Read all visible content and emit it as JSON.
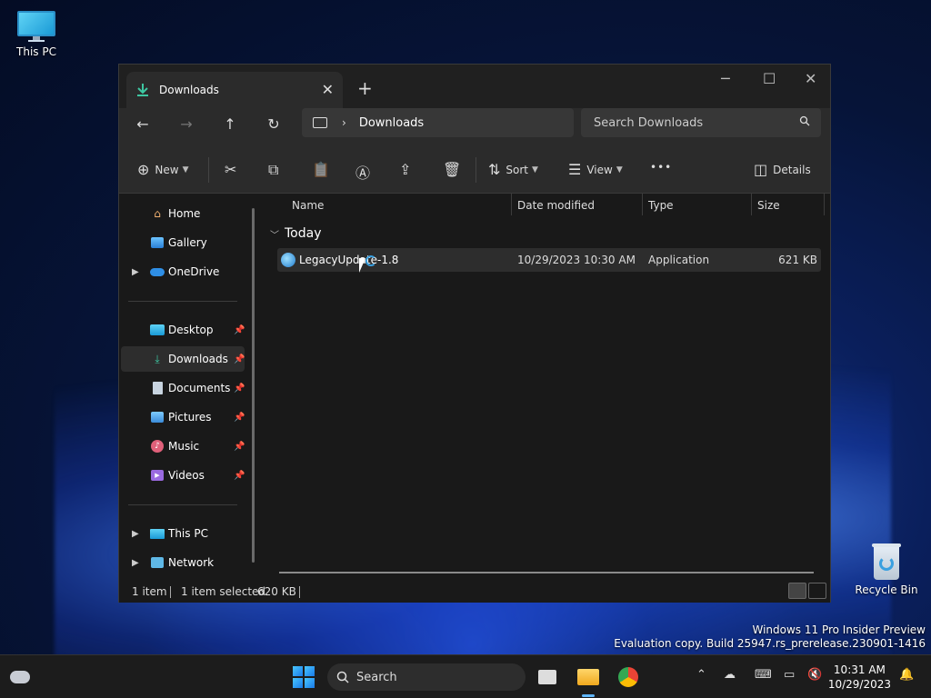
{
  "desktop": {
    "this_pc_label": "This PC",
    "recycle_bin_label": "Recycle Bin",
    "watermark_line1": "Windows 11 Pro Insider Preview",
    "watermark_line2": "Evaluation copy. Build 25947.rs_prerelease.230901-1416"
  },
  "window": {
    "tab_label": "Downloads",
    "tab_close": "✕",
    "new_tab": "+",
    "min": "─",
    "max": "☐",
    "close": "✕"
  },
  "address": {
    "back": "←",
    "forward": "→",
    "up": "↑",
    "refresh": "↻",
    "chevron": "›",
    "crumb": "Downloads",
    "search_placeholder": "Search Downloads"
  },
  "commands": {
    "new": "New",
    "cut": "✂",
    "copy": "⧉",
    "paste": "📋",
    "rename": "Ⓐ",
    "share": "⇪",
    "delete": "🗑",
    "sort": "Sort",
    "view": "View",
    "more": "•••",
    "details": "Details"
  },
  "nav": {
    "items": [
      {
        "label": "Home"
      },
      {
        "label": "Gallery"
      },
      {
        "label": "OneDrive"
      },
      {
        "label": "Desktop"
      },
      {
        "label": "Downloads"
      },
      {
        "label": "Documents"
      },
      {
        "label": "Pictures"
      },
      {
        "label": "Music"
      },
      {
        "label": "Videos"
      },
      {
        "label": "This PC"
      },
      {
        "label": "Network"
      }
    ]
  },
  "files": {
    "columns": [
      "Name",
      "Date modified",
      "Type",
      "Size"
    ],
    "group": "Today",
    "rows": [
      {
        "name": "LegacyUpdate-1.8",
        "date": "10/29/2023 10:30 AM",
        "type": "Application",
        "size": "621 KB"
      }
    ]
  },
  "status": {
    "count": "1 item",
    "selected": "1 item selected",
    "size": "620 KB"
  },
  "taskbar": {
    "search": "Search",
    "time": "10:31 AM",
    "date": "10/29/2023"
  }
}
